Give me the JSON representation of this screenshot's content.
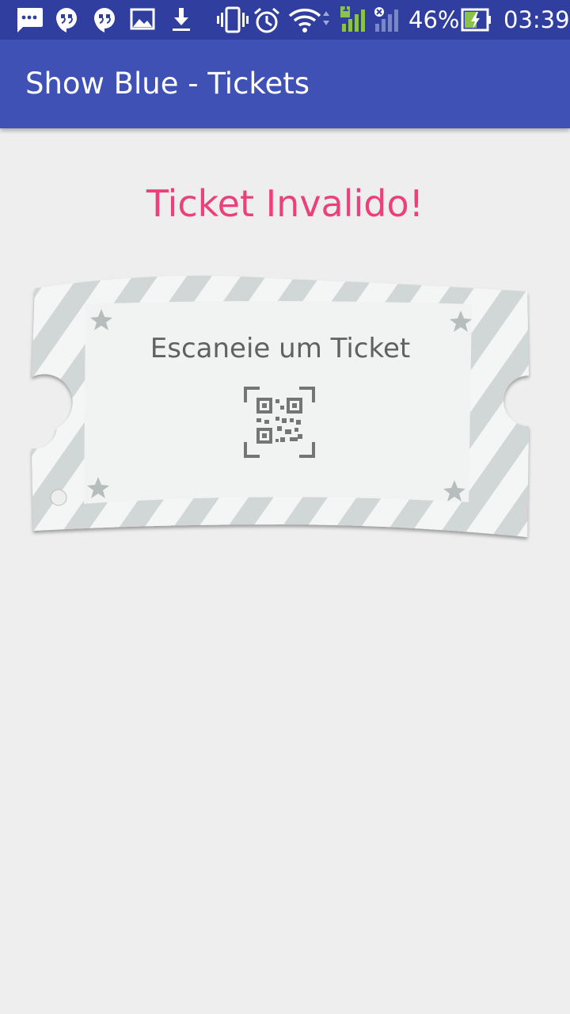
{
  "status_bar": {
    "icons": [
      "message-icon",
      "hangouts-icon",
      "hangouts-icon",
      "gallery-icon",
      "download-icon",
      "vibrate-icon",
      "alarm-icon",
      "wifi-icon",
      "signal-icon",
      "no-signal-icon",
      "battery-charging-icon"
    ],
    "sim_label": "1",
    "battery": "46%",
    "time": "03:39"
  },
  "app_bar": {
    "title": "Show Blue - Tickets"
  },
  "main": {
    "result_text": "Ticket Invalido!",
    "ticket_label": "Escaneie um Ticket",
    "ticket_icon": "qr-scan-icon"
  },
  "colors": {
    "status_bar": "#303f9f",
    "app_bar": "#3f51b5",
    "background": "#eeeeee",
    "result_text": "#ec407a"
  }
}
